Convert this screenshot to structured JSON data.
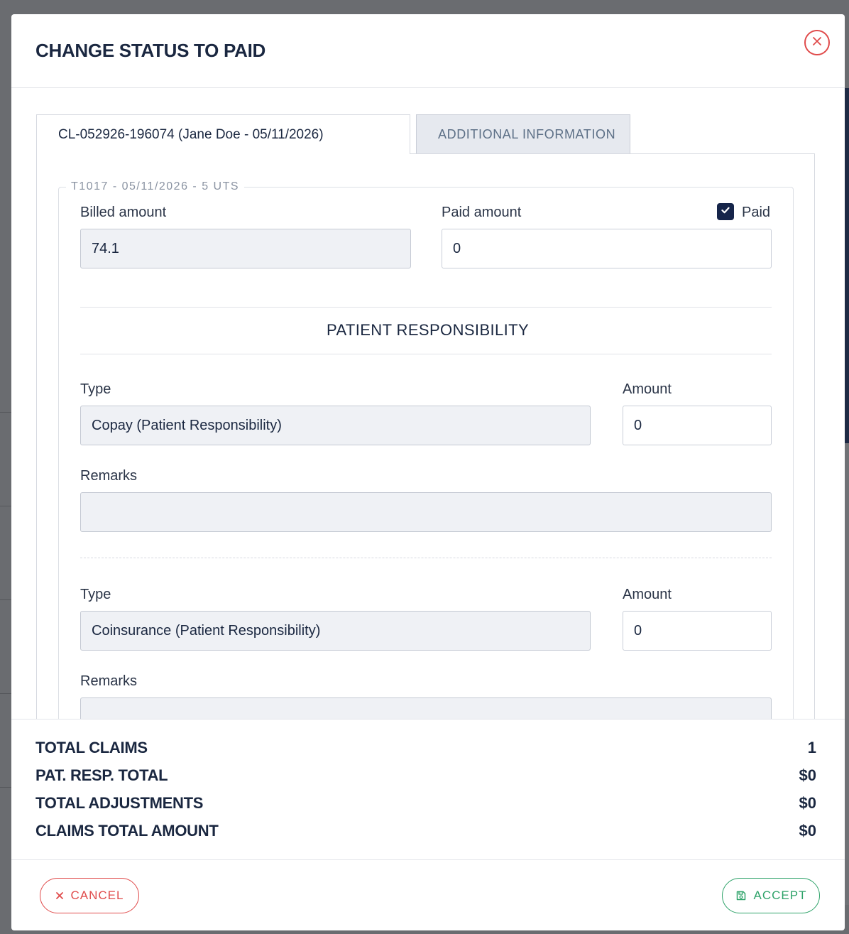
{
  "modal": {
    "title": "CHANGE STATUS TO PAID"
  },
  "tabs": [
    {
      "label": "CL-052926-196074 (Jane Doe - 05/11/2026)",
      "active": true
    },
    {
      "label": "ADDITIONAL INFORMATION",
      "active": false
    }
  ],
  "line_item": {
    "legend": "T1017 - 05/11/2026 - 5 UTS",
    "billed_amount": {
      "label": "Billed amount",
      "value": "74.1"
    },
    "paid_amount": {
      "label": "Paid amount",
      "value": "0"
    },
    "paid_checkbox": {
      "label": "Paid",
      "checked": true
    }
  },
  "patient_responsibility": {
    "title": "PATIENT RESPONSIBILITY",
    "entries": [
      {
        "type_label": "Type",
        "type_value": "Copay (Patient Responsibility)",
        "amount_label": "Amount",
        "amount_value": "0",
        "remarks_label": "Remarks",
        "remarks_value": ""
      },
      {
        "type_label": "Type",
        "type_value": "Coinsurance (Patient Responsibility)",
        "amount_label": "Amount",
        "amount_value": "0",
        "remarks_label": "Remarks",
        "remarks_value": ""
      }
    ]
  },
  "totals": [
    {
      "label": "TOTAL CLAIMS",
      "value": "1"
    },
    {
      "label": "PAT. RESP. TOTAL",
      "value": "$0"
    },
    {
      "label": "TOTAL ADJUSTMENTS",
      "value": "$0"
    },
    {
      "label": "CLAIMS TOTAL AMOUNT",
      "value": "$0"
    }
  ],
  "footer": {
    "cancel_label": "CANCEL",
    "accept_label": "ACCEPT"
  },
  "colors": {
    "primary": "#1a2740",
    "danger": "#e04b4b",
    "success": "#2fa36a"
  },
  "icons": {
    "close": "close-icon",
    "cancel": "x-icon",
    "accept": "save-icon",
    "check": "check-icon"
  }
}
